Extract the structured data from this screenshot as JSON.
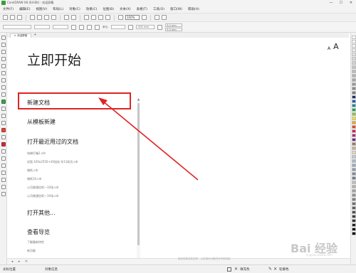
{
  "window": {
    "title": "CorelDRAW X8 (64-Bit) - 欢迎屏幕",
    "minimize": "—",
    "maximize": "☐",
    "close": "✕"
  },
  "menubar": {
    "items": [
      "文件(F)",
      "编辑(E)",
      "视图(V)",
      "布局(L)",
      "对象(C)",
      "效果(C)",
      "位图(B)",
      "文本(X)",
      "表格(T)",
      "工具(O)",
      "窗口(W)",
      "帮助(H)"
    ]
  },
  "toolbar": {
    "zoom_value": "100%"
  },
  "propbar": {
    "unit_label": "单位:",
    "nudge_value": ".001 mm",
    "dup_x": "5.0 mm",
    "dup_y": "5.0 mm"
  },
  "tabs": {
    "active_label": "欢迎屏幕",
    "add_label": "+"
  },
  "welcome": {
    "title": "立即开始",
    "text_small": "A",
    "text_large": "A",
    "new_document": "新建文档",
    "new_from_template": "从模板新建",
    "open_recent": "打开最近用过的文档",
    "recent_files": [
      "电梯灯箱2.cdr",
      "封面 420x2550+30加血 车11前员.cdr",
      "铺纸.cdr",
      "铺纸10.cdr",
      "公司普通信纸—10张.cdr",
      "公司普通信纸—10张.cdr"
    ],
    "open_other": "打开其他...",
    "view_guide": "查看导览",
    "guide_items": [
      "了解最新特性",
      "新功能"
    ]
  },
  "hint": "拖动将拖动到这样，以实现对对象的对齐和控制",
  "statusbar": {
    "cursor_position": "光标位置",
    "object_info": "对象信息",
    "fill_label": "填充色",
    "outline_label": "轮廓色"
  },
  "watermark": {
    "main": "Bai 经验",
    "sub": "jingyan.baidu.com"
  },
  "colors": {
    "highlight": "#e02424",
    "arrow": "#e02424"
  }
}
